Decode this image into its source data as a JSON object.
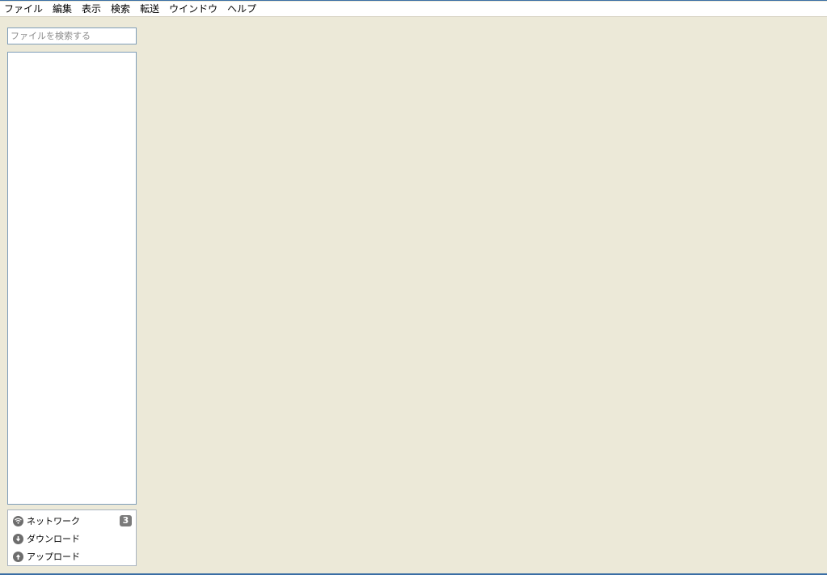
{
  "menubar": {
    "items": [
      "ファイル",
      "編集",
      "表示",
      "検索",
      "転送",
      "ウインドウ",
      "ヘルプ"
    ]
  },
  "search": {
    "placeholder": "ファイルを検索する",
    "value": ""
  },
  "nav": {
    "items": [
      {
        "label": "ネットワーク",
        "icon": "network-icon",
        "badge": "3"
      },
      {
        "label": "ダウンロード",
        "icon": "download-icon"
      },
      {
        "label": "アップロード",
        "icon": "upload-icon"
      }
    ]
  },
  "colors": {
    "background": "#ece9d8",
    "border": "#7f9db9",
    "icon": "#6d6d6d",
    "badge": "#7a7a7a"
  }
}
